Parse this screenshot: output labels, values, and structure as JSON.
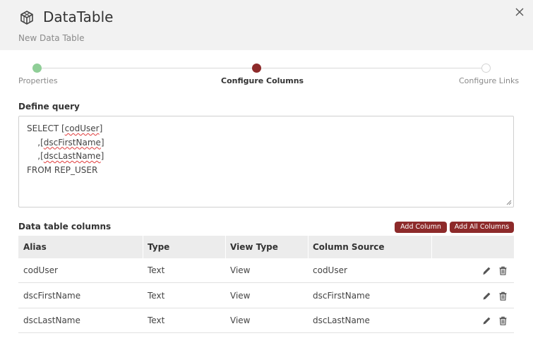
{
  "header": {
    "title": "DataTable",
    "subtitle": "New Data Table",
    "logo_icon": "cube-icon",
    "close_icon": "close-icon"
  },
  "stepper": {
    "steps": [
      {
        "label": "Properties",
        "state": "done"
      },
      {
        "label": "Configure Columns",
        "state": "active"
      },
      {
        "label": "Configure Links",
        "state": "todo"
      }
    ]
  },
  "query": {
    "label": "Define query",
    "lines": [
      "SELECT [codUser]",
      "    ,[dscFirstName]",
      "    ,[dscLastName]",
      "FROM REP_USER"
    ],
    "sql_prefix_1": "SELECT [",
    "sql_word_1": "codUser",
    "sql_suffix_1": "]",
    "sql_prefix_2": "    ,[",
    "sql_word_2": "dscFirstName",
    "sql_suffix_2": "]",
    "sql_prefix_3": "    ,[",
    "sql_word_3": "dscLastName",
    "sql_suffix_3": "]",
    "sql_line_4": "FROM REP_USER"
  },
  "columns_section": {
    "label": "Data table columns",
    "add_column_label": "Add Column",
    "add_all_columns_label": "Add All Columns",
    "headers": [
      "Alias",
      "Type",
      "View Type",
      "Column Source"
    ],
    "rows": [
      {
        "alias": "codUser",
        "type": "Text",
        "view_type": "View",
        "source": "codUser"
      },
      {
        "alias": "dscFirstName",
        "type": "Text",
        "view_type": "View",
        "source": "dscFirstName"
      },
      {
        "alias": "dscLastName",
        "type": "Text",
        "view_type": "View",
        "source": "dscLastName"
      }
    ],
    "row_icons": [
      "pencil-icon",
      "trash-icon"
    ]
  },
  "colors": {
    "accent": "#8d2a2a",
    "done": "#8fce97",
    "header_bg": "#f2f2f2"
  }
}
